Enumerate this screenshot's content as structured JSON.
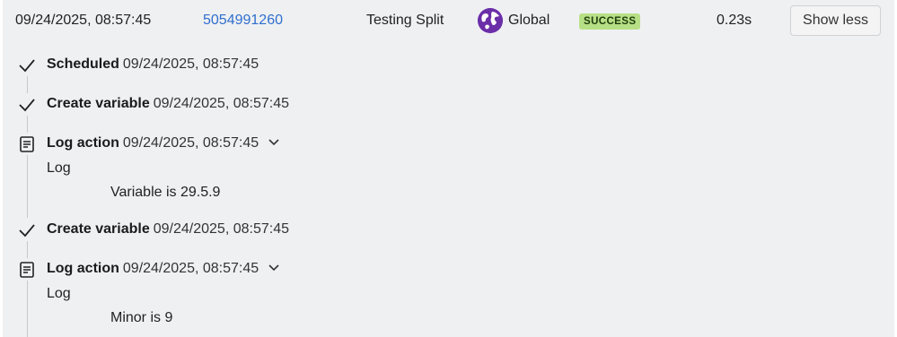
{
  "run": {
    "date": "09/24/2025, 08:57:45",
    "id": "5054991260",
    "workflow": "Testing Split",
    "environment": "Global",
    "status": "SUCCESS",
    "duration": "0.23s",
    "toggle_label": "Show less"
  },
  "steps": [
    {
      "title": "Scheduled",
      "timestamp": "09/24/2025, 08:57:45",
      "icon": "check-icon"
    },
    {
      "title": "Create variable",
      "timestamp": "09/24/2025, 08:57:45",
      "icon": "check-icon"
    },
    {
      "title": "Log action",
      "timestamp": "09/24/2025, 08:57:45",
      "icon": "log-icon",
      "log_label": "Log",
      "log_message": "Variable is 29.5.9"
    },
    {
      "title": "Create variable",
      "timestamp": "09/24/2025, 08:57:45",
      "icon": "check-icon"
    },
    {
      "title": "Log action",
      "timestamp": "09/24/2025, 08:57:45",
      "icon": "log-icon",
      "log_label": "Log",
      "log_message": "Minor is 9"
    }
  ],
  "colors": {
    "panel_bg": "#eff0f2",
    "link": "#2f6fce",
    "success_badge": "#b7df86",
    "env_globe": "#6b2fa8"
  }
}
